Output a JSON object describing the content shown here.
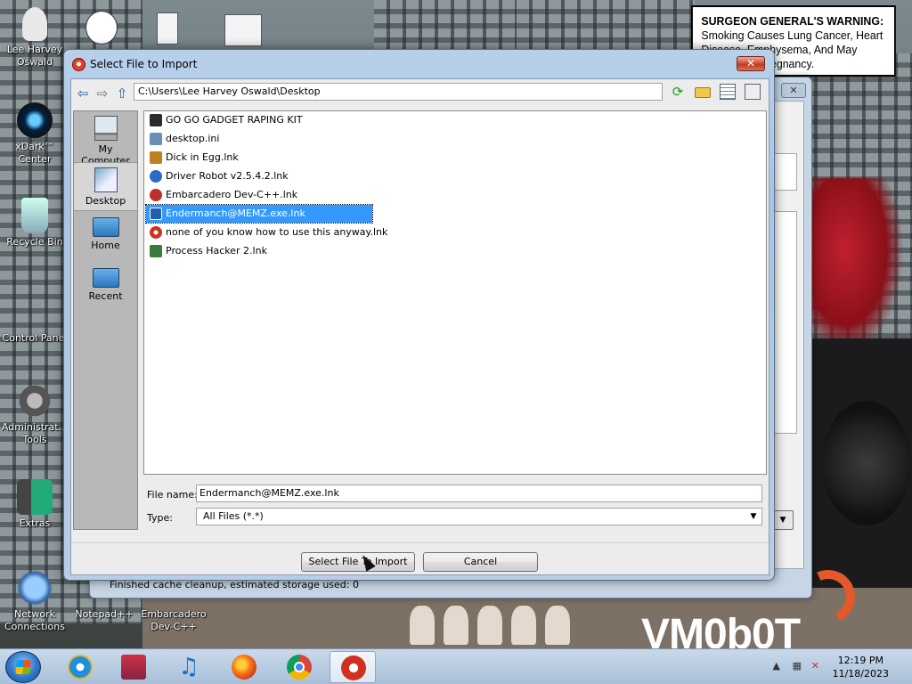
{
  "desktop": {
    "warning_title": "SURGEON GENERAL'S WARNING:",
    "warning_body": "Smoking Causes Lung Cancer, Heart Disease, Emphysema, And May Complicate Pregnancy.",
    "watermark": "VM0b0T",
    "icons": [
      {
        "label": "Lee Harvey Oswald",
        "icon": "person-icon"
      },
      {
        "label": "xDark™ Center",
        "icon": "orb-icon"
      },
      {
        "label": "Recycle Bin",
        "icon": "recycle-bin-icon"
      },
      {
        "label": "Control Panel",
        "icon": "control-panel-icon"
      },
      {
        "label": "Administrat... Tools",
        "icon": "admin-tools-icon"
      },
      {
        "label": "Extras",
        "icon": "extras-icon"
      },
      {
        "label": "Network Connections",
        "icon": "network-icon"
      },
      {
        "label": "Notepad++",
        "icon": "notepad-icon"
      },
      {
        "label": "Embarcadero Dev-C++",
        "icon": "devcpp-icon"
      }
    ]
  },
  "back_window": {
    "status": "Finished cache cleanup, estimated storage used: 0"
  },
  "dialog": {
    "title": "Select File to Import",
    "path": "C:\\Users\\Lee Harvey Oswald\\Desktop",
    "places": [
      {
        "label": "My Computer",
        "icon": "computer-icon"
      },
      {
        "label": "Desktop",
        "icon": "desktop-icon"
      },
      {
        "label": "Home",
        "icon": "home-icon"
      },
      {
        "label": "Recent",
        "icon": "recent-icon"
      }
    ],
    "files": [
      {
        "name": "GO GO GADGET RAPING KIT",
        "icon": "app-icon",
        "color": "#333333"
      },
      {
        "name": "desktop.ini",
        "icon": "settings-file-icon",
        "color": "#6a8fb5"
      },
      {
        "name": "Dick in Egg.lnk",
        "icon": "shortcut-icon",
        "color": "#c08020"
      },
      {
        "name": "Driver Robot v2.5.4.2.lnk",
        "icon": "robot-icon",
        "color": "#2a6ac8"
      },
      {
        "name": "Embarcadero Dev-C++.lnk",
        "icon": "devcpp-icon",
        "color": "#c0302a"
      },
      {
        "name": "Endermanch@MEMZ.exe.lnk",
        "icon": "exe-icon",
        "color": "#1f5fb0"
      },
      {
        "name": "none of you know how to use this anyway.lnk",
        "icon": "vm-icon",
        "color": "#d03020"
      },
      {
        "name": "Process Hacker 2.lnk",
        "icon": "process-hacker-icon",
        "color": "#3a7a3a"
      }
    ],
    "selected_index": 5,
    "file_name_label": "File name:",
    "file_name_value": "Endermanch@MEMZ.exe.lnk",
    "type_label": "Type:",
    "type_value": "All Files (*.*)",
    "ok_button": "Select File To Import",
    "cancel_button": "Cancel"
  },
  "taskbar": {
    "time": "12:19 PM",
    "date": "11/18/2023",
    "items": [
      "internet-explorer-icon",
      "media-icon",
      "music-icon",
      "firefox-icon",
      "chrome-icon",
      "vm-app-icon"
    ]
  }
}
